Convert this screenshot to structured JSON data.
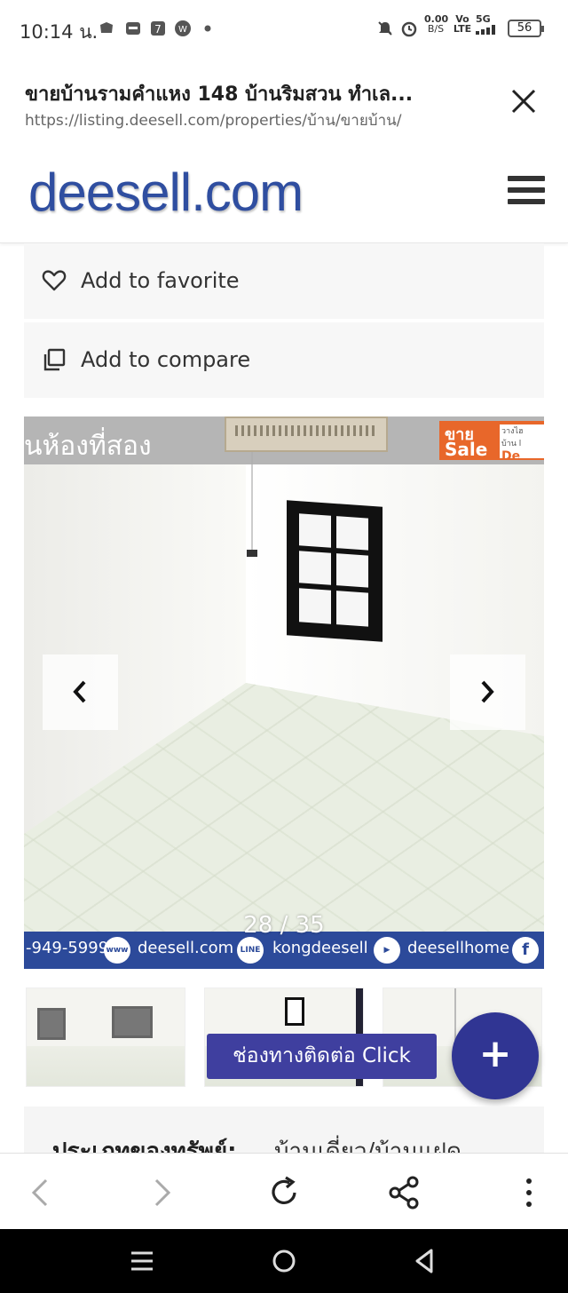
{
  "status_bar": {
    "time": "10:14 น.",
    "net_speed_value": "0.00",
    "net_speed_unit": "B/S",
    "volte_top": "Vo",
    "volte_bottom": "LTE",
    "network": "5G",
    "battery": "56"
  },
  "browser_header": {
    "page_title": "ขายบ้านรามคำแหง 148 บ้านริมสวน ทำเล...",
    "url": "https://listing.deesell.com/properties/บ้าน/ขายบ้าน/"
  },
  "site": {
    "logo_text": "deesell.com",
    "brand_color": "#2f4ea0"
  },
  "actions": {
    "favorite_label": "Add to favorite",
    "compare_label": "Add to compare"
  },
  "gallery": {
    "overlay_title": "นห้องที่สอง",
    "sale_thai": "ขาย",
    "sale_en": "Sale",
    "sale_side_line1": "วางไฮ",
    "sale_side_line2": "บ้าน l",
    "sale_side_line3": "De",
    "counter": "28 / 35",
    "footer_phone": "-949-5999",
    "footer_www_icon": "www",
    "footer_site": "deesell.com",
    "footer_line_icon": "LINE",
    "footer_line": "kongdeesell",
    "footer_youtube": "deesellhome",
    "footer_facebook_icon": "f"
  },
  "contact": {
    "label": "ช่องทางติดต่อ Click",
    "fab_symbol": "+"
  },
  "property_type": {
    "label": "ประเภทของทรัพย์:",
    "value": "บ้านเดี่ยว/บ้านแฝด"
  }
}
